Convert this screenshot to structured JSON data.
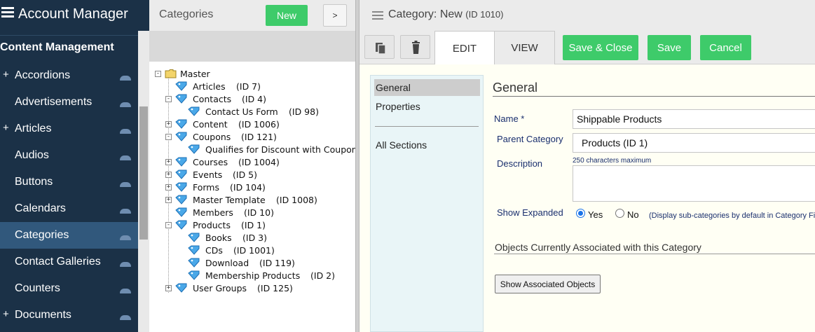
{
  "app": {
    "title": "Account Manager"
  },
  "nav": {
    "section": "Content Management",
    "items": [
      {
        "label": "Accordions",
        "expandable": true,
        "active": false
      },
      {
        "label": "Advertisements",
        "expandable": false,
        "active": false
      },
      {
        "label": "Articles",
        "expandable": true,
        "active": false
      },
      {
        "label": "Audios",
        "expandable": false,
        "active": false
      },
      {
        "label": "Buttons",
        "expandable": false,
        "active": false
      },
      {
        "label": "Calendars",
        "expandable": false,
        "active": false
      },
      {
        "label": "Categories",
        "expandable": false,
        "active": true
      },
      {
        "label": "Contact Galleries",
        "expandable": false,
        "active": false
      },
      {
        "label": "Counters",
        "expandable": false,
        "active": false
      },
      {
        "label": "Documents",
        "expandable": true,
        "active": false
      }
    ],
    "plus_glyph": "+"
  },
  "tree_panel": {
    "title": "Categories",
    "new_label": "New",
    "next_label": ">",
    "root": "Master",
    "nodes": [
      {
        "label": "Articles",
        "id": "(ID 7)",
        "level": 1,
        "expander": ""
      },
      {
        "label": "Contacts",
        "id": "(ID 4)",
        "level": 1,
        "expander": "-"
      },
      {
        "label": "Contact Us Form",
        "id": "(ID 98)",
        "level": 2,
        "expander": ""
      },
      {
        "label": "Content",
        "id": "(ID 1006)",
        "level": 1,
        "expander": "+"
      },
      {
        "label": "Coupons",
        "id": "(ID 121)",
        "level": 1,
        "expander": "-"
      },
      {
        "label": "Qualifies for Discount with Coupon",
        "id": "",
        "level": 2,
        "expander": ""
      },
      {
        "label": "Courses",
        "id": "(ID 1004)",
        "level": 1,
        "expander": "+"
      },
      {
        "label": "Events",
        "id": "(ID 5)",
        "level": 1,
        "expander": "+"
      },
      {
        "label": "Forms",
        "id": "(ID 104)",
        "level": 1,
        "expander": "+"
      },
      {
        "label": "Master Template",
        "id": "(ID 1008)",
        "level": 1,
        "expander": "+"
      },
      {
        "label": "Members",
        "id": "(ID 10)",
        "level": 1,
        "expander": ""
      },
      {
        "label": "Products",
        "id": "(ID 1)",
        "level": 1,
        "expander": "-"
      },
      {
        "label": "Books",
        "id": "(ID 3)",
        "level": 2,
        "expander": ""
      },
      {
        "label": "CDs",
        "id": "(ID 1001)",
        "level": 2,
        "expander": ""
      },
      {
        "label": "Download",
        "id": "(ID 119)",
        "level": 2,
        "expander": ""
      },
      {
        "label": "Membership Products",
        "id": "(ID 2)",
        "level": 2,
        "expander": ""
      },
      {
        "label": "User Groups",
        "id": "(ID 125)",
        "level": 1,
        "expander": "+"
      }
    ]
  },
  "editor": {
    "title": "Category: New",
    "title_id": "(ID 1010)",
    "tabs": {
      "edit": "EDIT",
      "view": "VIEW"
    },
    "buttons": {
      "save_close": "Save & Close",
      "save": "Save",
      "cancel": "Cancel"
    },
    "sections": {
      "general": "General",
      "properties": "Properties",
      "all": "All Sections"
    },
    "form": {
      "heading": "General",
      "name_label": "Name *",
      "name_value": "Shippable Products",
      "parent_label": "Parent Category",
      "parent_value": "Products  (ID 1)",
      "description_label": "Description",
      "description_hint": "250 characters maximum",
      "show_expanded_label": "Show Expanded",
      "yes_label": "Yes",
      "no_label": "No",
      "show_expanded_value": "Yes",
      "expand_note": "(Display sub-categories by default in Category Fi",
      "assoc_heading": "Objects Currently Associated with this Category",
      "assoc_button": "Show Associated Objects"
    }
  },
  "colors": {
    "nav_bg": "#1b3147",
    "nav_active": "#31587c",
    "green_button": "#3ecb6a",
    "label_blue": "#1a2f6e"
  },
  "icons": {
    "menu": "hamburger-icon",
    "folder": "folder-icon",
    "category": "category-tag-icon",
    "copy": "copy-icon",
    "delete": "trash-icon",
    "collapse": "chevron-up-icon"
  }
}
